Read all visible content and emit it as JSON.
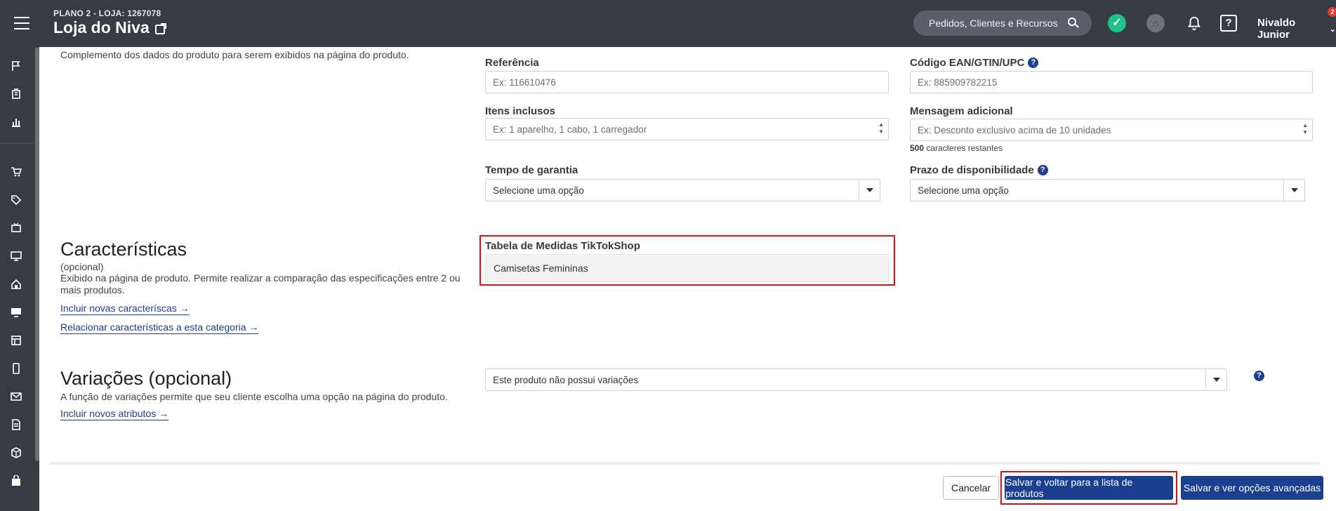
{
  "topbar": {
    "plan": "PLANO 2 - LOJA: 1267078",
    "store_name": "Loja do Niva",
    "search_placeholder": "Pedidos, Clientes e Recursos",
    "user_name": "Nivaldo Junior",
    "notification_count": "2",
    "help_icon_glyph": "?"
  },
  "sidebar": {
    "icons": [
      "flag-icon",
      "building-icon",
      "chart-icon",
      "cart-icon",
      "tag-icon",
      "tv-icon",
      "monitor-icon",
      "home-icon",
      "display-icon",
      "layout-icon",
      "mobile-icon",
      "mail-icon",
      "document-icon",
      "box-icon",
      "bag-icon"
    ]
  },
  "content": {
    "intro": "Complemento dos dados do produto para serem exibidos na página do produto.",
    "referencia": {
      "label": "Referência",
      "placeholder": "Ex: 116610476"
    },
    "ean": {
      "label": "Código EAN/GTIN/UPC",
      "placeholder": "Ex: 885909782215"
    },
    "itens": {
      "label": "Itens inclusos",
      "placeholder": "Ex: 1 aparelho, 1 cabo, 1 carregador"
    },
    "mensagem": {
      "label": "Mensagem adicional",
      "placeholder": "Ex: Desconto exclusivo acima de 10 unidades",
      "remaining_count": "500",
      "remaining_text": "caracteres restantes"
    },
    "garantia": {
      "label": "Tempo de garantia",
      "value": "Selecione uma opção"
    },
    "prazo": {
      "label": "Prazo de disponibilidade",
      "value": "Selecione uma opção"
    },
    "help_glyph": "?"
  },
  "caracteristicas": {
    "title": "Características",
    "subtitle": "(opcional)",
    "description": "Exibido na página de produto. Permite realizar a comparação das especificações entre 2 ou mais produtos.",
    "link_new": "Incluir novas caracteríscas",
    "link_relate": "Relacionar características a esta categoria",
    "tabela_label": "Tabela de Medidas TikTokShop",
    "tabela_value": "Camisetas Femininas"
  },
  "variacoes": {
    "title": "Variações (opcional)",
    "description": "A função de variações permite que seu cliente escolha uma opção na página do produto.",
    "link_new": "Incluir novos atributos",
    "select_value": "Este produto não possui variações"
  },
  "footer": {
    "cancel": "Cancelar",
    "save_back": "Salvar e voltar para a lista de produtos",
    "save_advanced": "Salvar e ver opções avançadas"
  },
  "colors": {
    "topbar": "#363b44",
    "primary": "#1c3f8f",
    "highlight": "#e0101a",
    "success": "#1ec28b"
  }
}
